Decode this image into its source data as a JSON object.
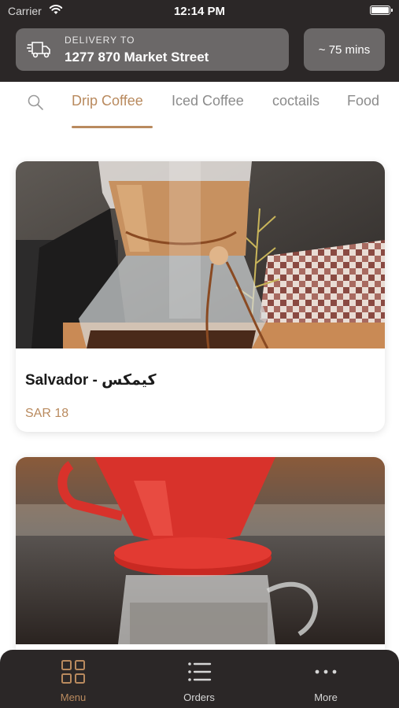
{
  "status_bar": {
    "carrier": "Carrier",
    "time": "12:14 PM"
  },
  "header": {
    "delivery_caption": "DELIVERY TO",
    "delivery_address": "1277 870 Market Street",
    "eta": "~ 75 mins",
    "icons": [
      "wifi-icon",
      "battery-icon",
      "truck-icon"
    ]
  },
  "tabs": {
    "items": [
      {
        "label": "Drip Coffee",
        "active": true
      },
      {
        "label": "Iced Coffee",
        "active": false
      },
      {
        "label": "coctails",
        "active": false
      },
      {
        "label": "Food",
        "active": false
      }
    ],
    "search_icon": "search-icon"
  },
  "products": [
    {
      "name": "Salvador - كيمكس",
      "price": "SAR 18",
      "image": "chemex-coffee-maker"
    },
    {
      "name": "",
      "price": "",
      "image": "red-v60-dripper"
    }
  ],
  "bottom_nav": {
    "items": [
      {
        "label": "Menu",
        "icon": "grid-icon",
        "active": true
      },
      {
        "label": "Orders",
        "icon": "list-icon",
        "active": false
      },
      {
        "label": "More",
        "icon": "more-icon",
        "active": false
      }
    ]
  },
  "colors": {
    "header_bg": "#2b2727",
    "card_bg": "#6b6868",
    "accent": "#b98a5e",
    "tab_inactive": "#8b8b8b"
  }
}
